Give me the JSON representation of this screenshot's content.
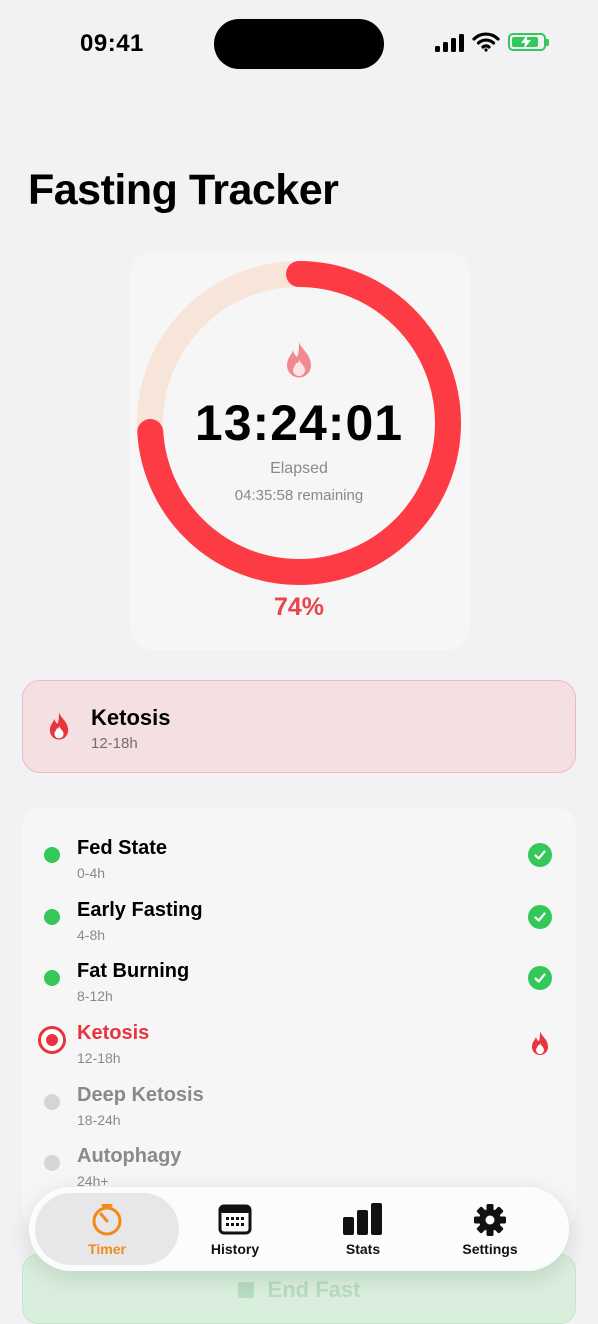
{
  "status_bar": {
    "time": "09:41"
  },
  "page_title": "Fasting Tracker",
  "timer": {
    "elapsed": "13:24:01",
    "elapsed_label": "Elapsed",
    "remaining": "04:35:58 remaining",
    "percent_label": "74%",
    "progress": 0.74,
    "ring_color": "#fd3b45",
    "track_color": "#f6e5d8"
  },
  "current_phase": {
    "name": "Ketosis",
    "range": "12-18h",
    "icon": "flame-icon"
  },
  "phases": [
    {
      "name": "Fed State",
      "range": "0-4h",
      "state": "done"
    },
    {
      "name": "Early Fasting",
      "range": "4-8h",
      "state": "done"
    },
    {
      "name": "Fat Burning",
      "range": "8-12h",
      "state": "done"
    },
    {
      "name": "Ketosis",
      "range": "12-18h",
      "state": "current"
    },
    {
      "name": "Deep Ketosis",
      "range": "18-24h",
      "state": "future"
    },
    {
      "name": "Autophagy",
      "range": "24h+",
      "state": "future"
    }
  ],
  "end_fast_label": "End Fast",
  "tabs": [
    {
      "label": "Timer",
      "icon": "timer-icon",
      "active": true
    },
    {
      "label": "History",
      "icon": "calendar-icon",
      "active": false
    },
    {
      "label": "Stats",
      "icon": "bar-chart-icon",
      "active": false
    },
    {
      "label": "Settings",
      "icon": "gear-icon",
      "active": false
    }
  ],
  "colors": {
    "accent": "#f28a1a",
    "danger": "#e8343c",
    "success": "#34c759"
  }
}
